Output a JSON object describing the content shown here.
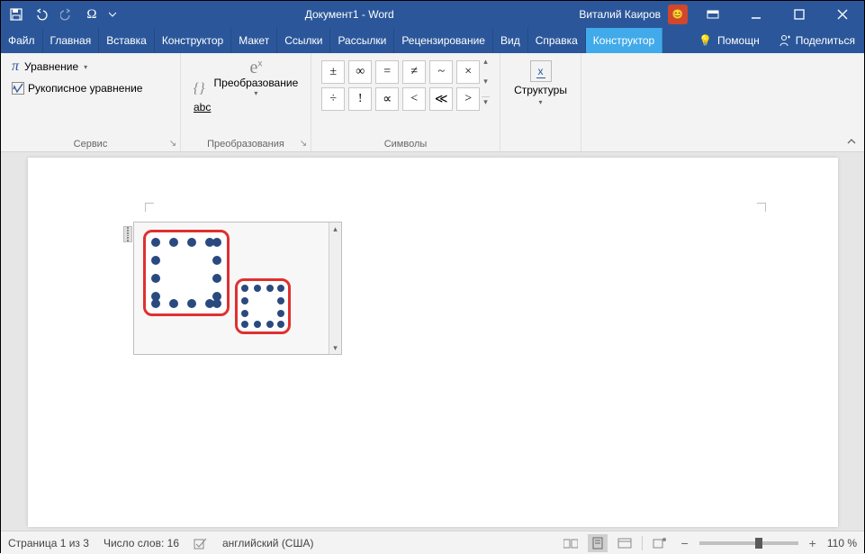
{
  "titlebar": {
    "doc_title": "Документ1  -  Word",
    "user_name": "Виталий Каиров"
  },
  "tabs": {
    "file": "Файл",
    "home": "Главная",
    "insert": "Вставка",
    "design": "Конструктор",
    "layout": "Макет",
    "references": "Ссылки",
    "mailings": "Рассылки",
    "review": "Рецензирование",
    "view": "Вид",
    "help": "Справка",
    "eq_design": "Конструктор",
    "tell_me": "Помощн",
    "share": "Поделиться"
  },
  "ribbon": {
    "tools": {
      "equation": "Уравнение",
      "ink": "Рукописное уравнение",
      "group": "Сервис"
    },
    "conversions": {
      "convert": "Преобразование",
      "abc": "abc",
      "group": "Преобразования"
    },
    "symbols": {
      "group": "Символы",
      "row1": [
        "±",
        "∞",
        "=",
        "≠",
        "~",
        "×"
      ],
      "row2": [
        "÷",
        "!",
        "∝",
        "<",
        "≪",
        ">"
      ]
    },
    "structures": {
      "button": "Структуры",
      "group": ""
    }
  },
  "status": {
    "page": "Страница 1 из 3",
    "words": "Число слов: 16",
    "language": "английский (США)",
    "zoom": "110 %"
  }
}
